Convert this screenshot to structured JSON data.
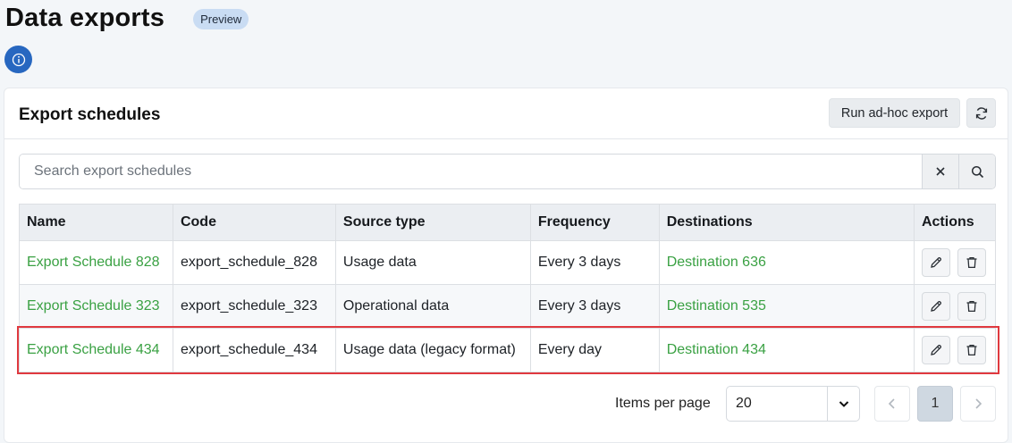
{
  "page": {
    "title": "Data exports",
    "badge": "Preview"
  },
  "card": {
    "title": "Export schedules",
    "run_adhoc_label": "Run ad-hoc export"
  },
  "search": {
    "placeholder": "Search export schedules",
    "value": ""
  },
  "table": {
    "columns": [
      "Name",
      "Code",
      "Source type",
      "Frequency",
      "Destinations",
      "Actions"
    ],
    "rows": [
      {
        "name": "Export Schedule 828",
        "code": "export_schedule_828",
        "source_type": "Usage data",
        "frequency": "Every 3 days",
        "destination": "Destination 636"
      },
      {
        "name": "Export Schedule 323",
        "code": "export_schedule_323",
        "source_type": "Operational data",
        "frequency": "Every 3 days",
        "destination": "Destination 535"
      },
      {
        "name": "Export Schedule 434",
        "code": "export_schedule_434",
        "source_type": "Usage data (legacy format)",
        "frequency": "Every day",
        "destination": "Destination 434"
      }
    ]
  },
  "pagination": {
    "items_per_page_label": "Items per page",
    "items_per_page_value": "20",
    "current_page": "1"
  },
  "colors": {
    "accent": "#2767c0",
    "link": "#3aa143",
    "highlight": "#e0393f"
  }
}
